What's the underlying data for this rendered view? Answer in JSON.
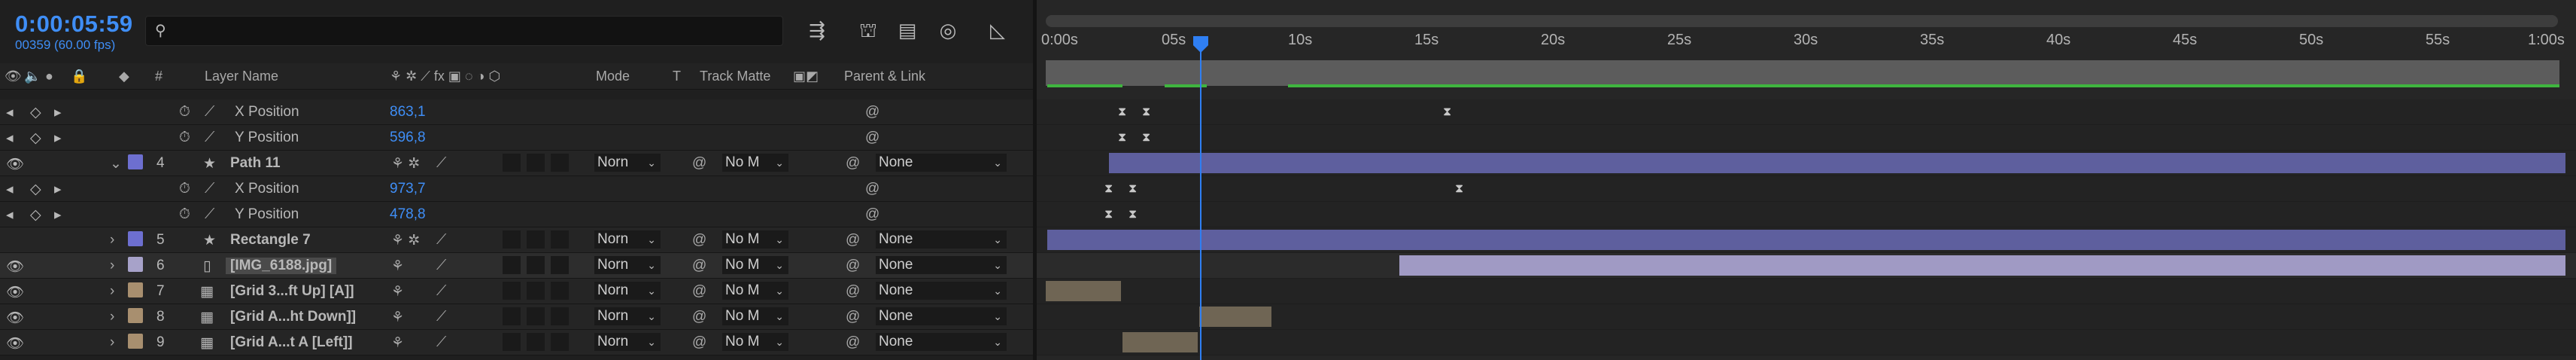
{
  "header": {
    "timecode": "0:00:05:59",
    "frame_info": "00359 (60.00 fps)",
    "search_placeholder": "",
    "search_icon": "search-icon"
  },
  "columns": {
    "layer_name": "Layer Name",
    "num": "#",
    "mode": "Mode",
    "t": "T",
    "track_matte": "Track Matte",
    "parent_link": "Parent & Link"
  },
  "rows": [
    {
      "kind": "prop",
      "name": "X Position",
      "value": "863,1"
    },
    {
      "kind": "prop",
      "name": "Y Position",
      "value": "596,8"
    },
    {
      "kind": "layer",
      "num": "4",
      "name": "Path 11",
      "color": "#6d6fd0",
      "type": "shape",
      "mode": "Norn",
      "matte": "No M",
      "parent": "None",
      "expanded": true
    },
    {
      "kind": "prop",
      "name": "X Position",
      "value": "973,7"
    },
    {
      "kind": "prop",
      "name": "Y Position",
      "value": "478,8"
    },
    {
      "kind": "layer",
      "num": "5",
      "name": "Rectangle 7",
      "color": "#6d6fd0",
      "type": "shape",
      "mode": "Norn",
      "matte": "No M",
      "parent": "None"
    },
    {
      "kind": "layer",
      "num": "6",
      "name": "[IMG_6188.jpg]",
      "color": "#a7a2c9",
      "type": "file",
      "mode": "Norn",
      "matte": "No M",
      "parent": "None",
      "selected": true
    },
    {
      "kind": "layer",
      "num": "7",
      "name": "[Grid 3...ft Up] [A]]",
      "color": "#a88f6f",
      "type": "comp",
      "mode": "Norn",
      "matte": "No M",
      "parent": "None"
    },
    {
      "kind": "layer",
      "num": "8",
      "name": "[Grid A...ht Down]]",
      "color": "#a88f6f",
      "type": "comp",
      "mode": "Norn",
      "matte": "No M",
      "parent": "None"
    },
    {
      "kind": "layer",
      "num": "9",
      "name": "[Grid A...t A [Left]]",
      "color": "#a88f6f",
      "type": "comp",
      "mode": "Norn",
      "matte": "No M",
      "parent": "None"
    }
  ],
  "ruler": {
    "labels": [
      "0:00s",
      "05s",
      "10s",
      "15s",
      "20s",
      "25s",
      "30s",
      "35s",
      "40s",
      "45s",
      "50s",
      "55s",
      "1:00s"
    ]
  },
  "colors": {
    "accent": "#3f8ef6",
    "shape_bar": "#5e5f9e",
    "image_bar": "#a09ac4",
    "comp_bar": "#6f6554",
    "work_area_green": "#3fb53f"
  }
}
